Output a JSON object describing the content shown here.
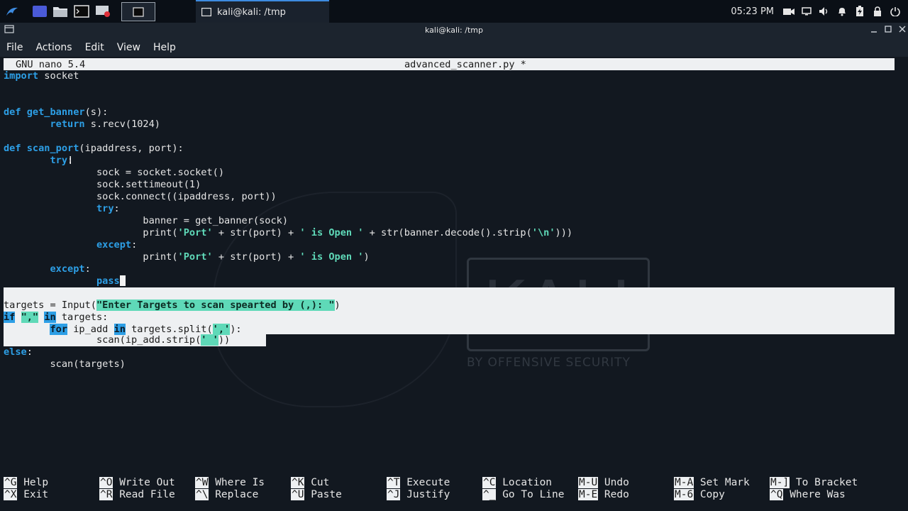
{
  "taskbar": {
    "task_title": "kali@kali: /tmp",
    "clock": "05:23 PM"
  },
  "window": {
    "title": "kali@kali: /tmp"
  },
  "menu": {
    "file": "File",
    "actions": "Actions",
    "edit": "Edit",
    "view": "View",
    "help": "Help"
  },
  "nano": {
    "version": "GNU nano 5.4",
    "filename": "advanced_scanner.py *"
  },
  "code": {
    "l1": {
      "kw": "import",
      "rest": " socket"
    },
    "l4": {
      "kw": "def",
      "fn": "get_banner",
      "rest": "(s):"
    },
    "l5": {
      "indent": "        ",
      "kw": "return",
      "rest": " s.recv(1024)"
    },
    "l7": {
      "kw": "def",
      "fn": "scan_port",
      "rest": "(ipaddress, port):"
    },
    "l8": {
      "indent": "        ",
      "kw": "try",
      "rest": ":"
    },
    "l9": "                sock = socket.socket()",
    "l10": "                sock.settimeout(1)",
    "l11": "                sock.connect((ipaddress, port))",
    "l12": {
      "indent": "                ",
      "kw": "try",
      "rest": ":"
    },
    "l13": "                        banner = get_banner(sock)",
    "l14": {
      "a": "                        print(",
      "s1": "'Port'",
      "b": " + str(port) + ",
      "s2": "' is Open '",
      "c": " + str(banner.decode().strip(",
      "s3": "'\\n'",
      "d": ")))"
    },
    "l15": {
      "indent": "                ",
      "kw": "except",
      "rest": ":"
    },
    "l16": {
      "a": "                        print(",
      "s1": "'Port'",
      "b": " + str(port) + ",
      "s2": "' is Open '",
      "c": ")"
    },
    "l17": {
      "indent": "        ",
      "kw": "except",
      "rest": ":"
    },
    "l18": {
      "indent": "                ",
      "kw": "pass"
    },
    "l20": {
      "a": "targets = Input(",
      "s1": "\"Enter Targets to scan spearted by (,): \"",
      "b": ")"
    },
    "l21": {
      "kw1": "if",
      "sp": " ",
      "s1": "\",\"",
      "sp2": " ",
      "kw2": "in",
      "rest": " targets:"
    },
    "l22": {
      "indent": "        ",
      "kw1": "for",
      "mid": " ip_add ",
      "kw2": "in",
      "rest": " targets.split(",
      "s1": "','",
      "end": "):"
    },
    "l23": {
      "a": "                scan(ip_add.strip(",
      "s1": "' '",
      "b": "))"
    },
    "l24": {
      "kw": "else",
      "rest": ":"
    },
    "l25": "        scan(targets)"
  },
  "shortcuts": [
    {
      "key": "^G",
      "label": "Help"
    },
    {
      "key": "^X",
      "label": "Exit"
    },
    {
      "key": "^O",
      "label": "Write Out"
    },
    {
      "key": "^R",
      "label": "Read File"
    },
    {
      "key": "^W",
      "label": "Where Is"
    },
    {
      "key": "^\\",
      "label": "Replace"
    },
    {
      "key": "^K",
      "label": "Cut"
    },
    {
      "key": "^U",
      "label": "Paste"
    },
    {
      "key": "^T",
      "label": "Execute"
    },
    {
      "key": "^J",
      "label": "Justify"
    },
    {
      "key": "^C",
      "label": "Location"
    },
    {
      "key": "^_",
      "label": "Go To Line"
    },
    {
      "key": "M-U",
      "label": "Undo"
    },
    {
      "key": "M-E",
      "label": "Redo"
    },
    {
      "key": "M-A",
      "label": "Set Mark"
    },
    {
      "key": "M-6",
      "label": "Copy"
    },
    {
      "key": "M-]",
      "label": "To Bracket"
    },
    {
      "key": "^Q",
      "label": "Where Was"
    }
  ],
  "colors": {
    "keyword": "#2d9fe6",
    "string": "#5fd9b8",
    "terminal_bg": "#121820",
    "panel_bg": "#0a0f16",
    "accent": "#3d8be0"
  }
}
